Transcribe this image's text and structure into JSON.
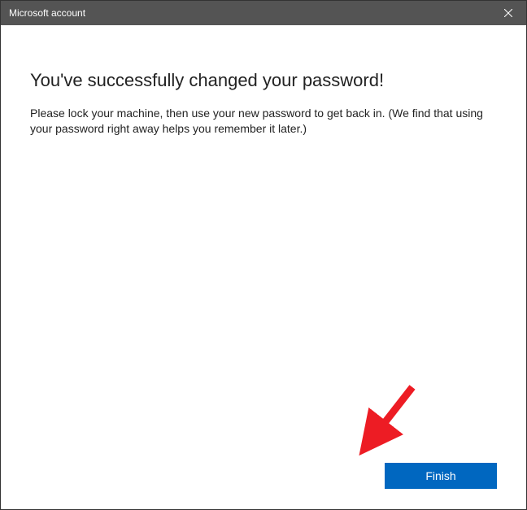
{
  "titlebar": {
    "title": "Microsoft account"
  },
  "content": {
    "heading": "You've successfully changed your password!",
    "body": "Please lock your machine, then use your new password to get back in. (We find that using your password right away helps you remember it later.)"
  },
  "footer": {
    "finish_label": "Finish"
  }
}
